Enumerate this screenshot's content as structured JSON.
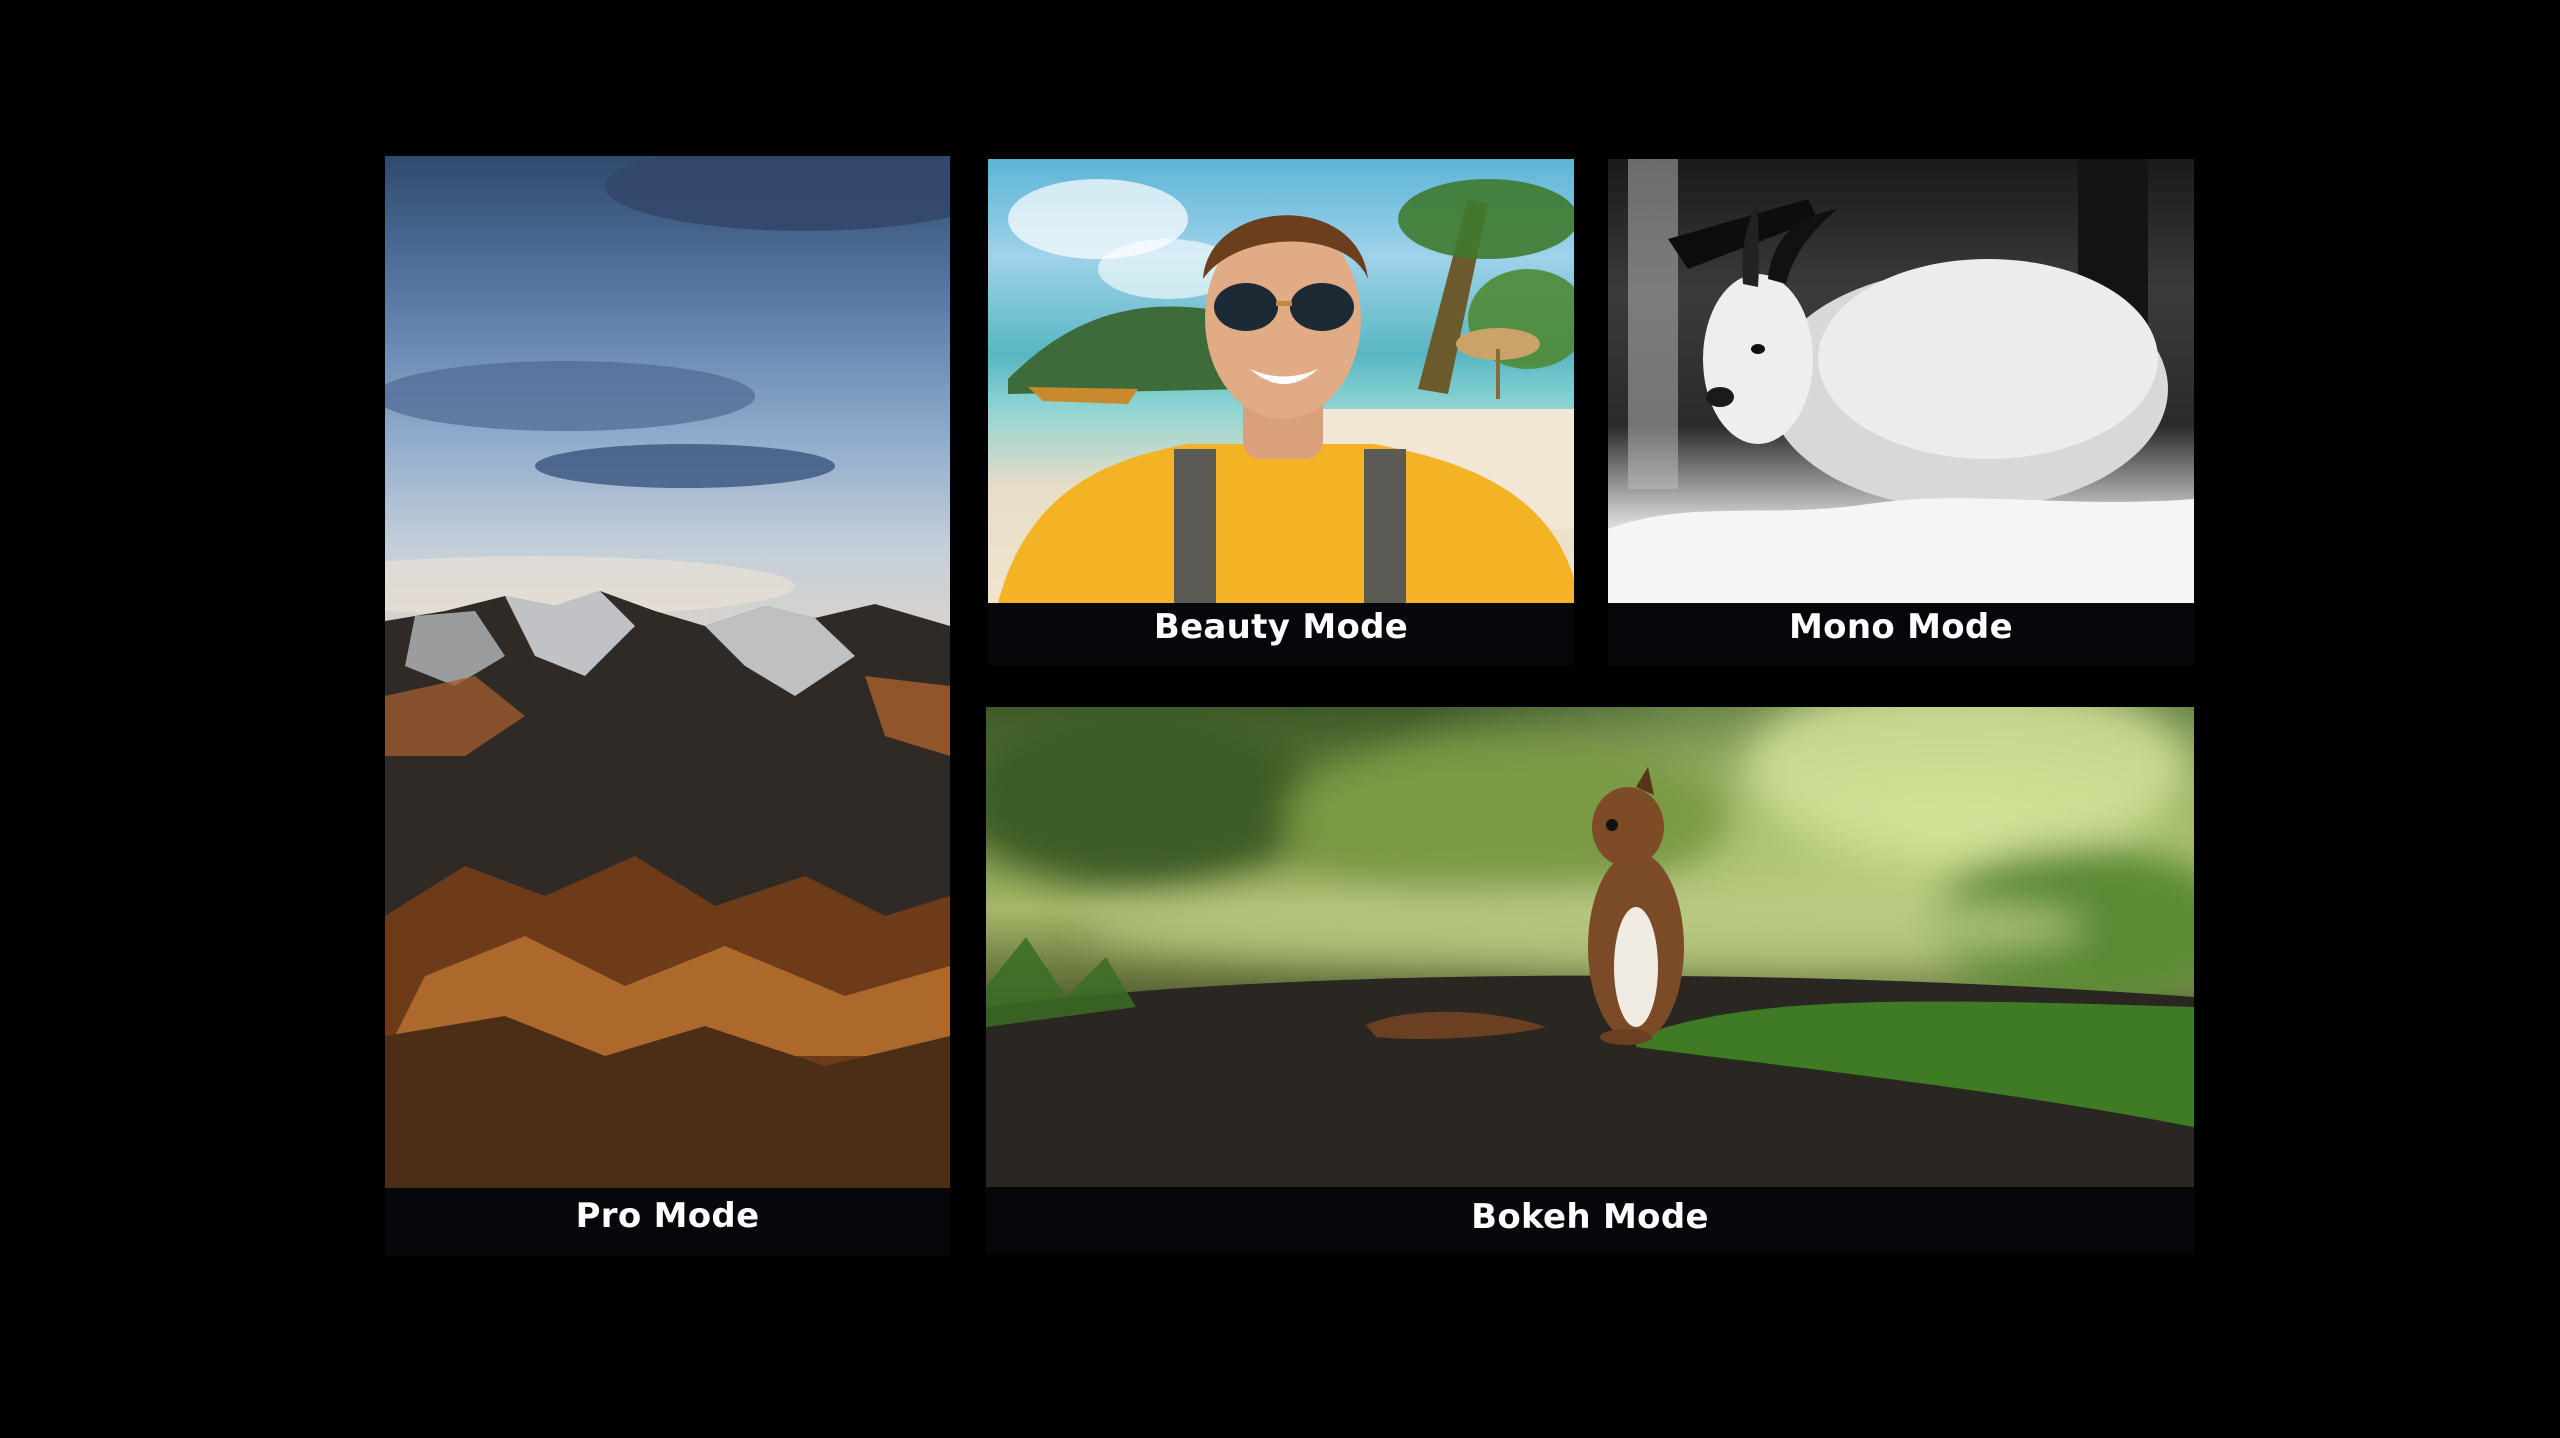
{
  "tiles": {
    "pro": {
      "label": "Pro Mode"
    },
    "beauty": {
      "label": "Beauty Mode"
    },
    "mono": {
      "label": "Mono Mode"
    },
    "bokeh": {
      "label": "Bokeh Mode"
    }
  }
}
